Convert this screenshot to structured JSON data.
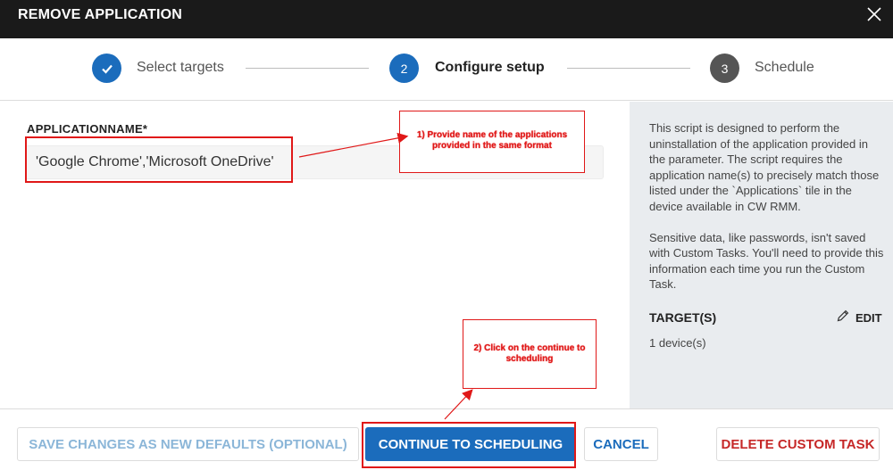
{
  "dialog": {
    "title": "REMOVE APPLICATION"
  },
  "stepper": {
    "steps": [
      {
        "number": "",
        "label": "Select targets",
        "state": "complete"
      },
      {
        "number": "2",
        "label": "Configure setup",
        "state": "active"
      },
      {
        "number": "3",
        "label": "Schedule",
        "state": "pending"
      }
    ]
  },
  "form": {
    "field_label": "APPLICATIONNAME*",
    "field_value": "'Google Chrome','Microsoft OneDrive'"
  },
  "sidebar": {
    "description_p1": "This script is designed to perform the uninstallation of the application provided in the parameter. The script requires the application name(s) to precisely match those listed under the `Applications` tile in the device available in CW RMM.",
    "description_p2": "Sensitive data, like passwords, isn't saved with Custom Tasks. You'll need to provide this information each time you run the Custom Task.",
    "targets_label": "TARGET(S)",
    "edit_label": "EDIT",
    "targets_value": "1 device(s)"
  },
  "footer": {
    "save_defaults_label": "SAVE CHANGES AS NEW DEFAULTS (OPTIONAL)",
    "continue_label": "CONTINUE TO SCHEDULING",
    "cancel_label": "CANCEL",
    "delete_label": "DELETE CUSTOM TASK"
  },
  "annotations": {
    "note1_line1": "1) Provide name of the applications",
    "note1_line2": "provided in the same format",
    "note2_line1": "2) Click on the continue to",
    "note2_line2": "scheduling"
  },
  "colors": {
    "titlebar": "#1a1a1a",
    "accent": "#1b6cbc",
    "step_complete": "#1b6cbc",
    "step_active": "#1b6cbc",
    "step_pending": "#555555",
    "danger": "#c62828",
    "annotation": "#e01818",
    "sidebar_bg": "#e9ecef"
  }
}
